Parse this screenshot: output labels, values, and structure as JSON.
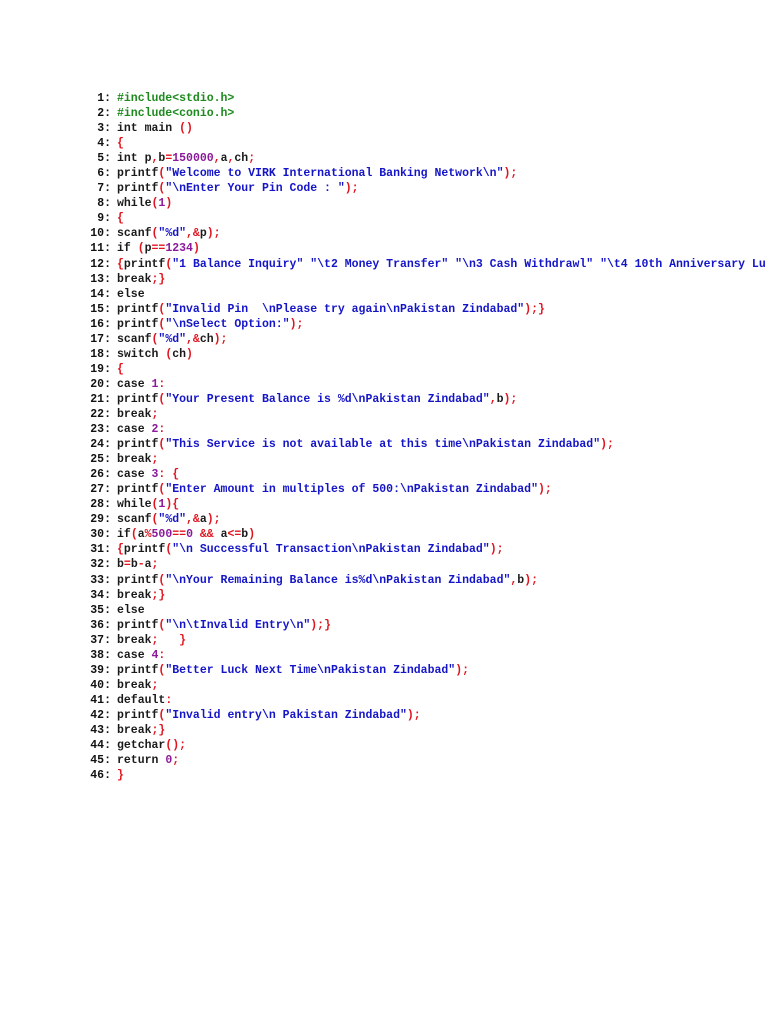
{
  "colors": {
    "keyword": "#1a1a1a",
    "punct": "#e0141e",
    "number": "#8b1a9a",
    "string": "#1515c8",
    "directive": "#1e8a1e"
  },
  "lines": [
    {
      "num": "1:",
      "t": [
        [
          "d",
          "#include<stdio.h>"
        ]
      ]
    },
    {
      "num": "2:",
      "t": [
        [
          "d",
          "#include<conio.h>"
        ]
      ]
    },
    {
      "num": "3:",
      "t": [
        [
          "k",
          "int main "
        ],
        [
          "p",
          "()"
        ]
      ]
    },
    {
      "num": "4:",
      "t": [
        [
          "p",
          "{"
        ]
      ]
    },
    {
      "num": "5:",
      "t": [
        [
          "k",
          "int p"
        ],
        [
          "p",
          ","
        ],
        [
          "k",
          "b"
        ],
        [
          "p",
          "="
        ],
        [
          "n",
          "150000"
        ],
        [
          "p",
          ","
        ],
        [
          "k",
          "a"
        ],
        [
          "p",
          ","
        ],
        [
          "k",
          "ch"
        ],
        [
          "p",
          ";"
        ]
      ]
    },
    {
      "num": "6:",
      "t": [
        [
          "k",
          "printf"
        ],
        [
          "p",
          "("
        ],
        [
          "s",
          "\"Welcome to VIRK International Banking Network\\n\""
        ],
        [
          "p",
          ");"
        ]
      ]
    },
    {
      "num": "7:",
      "t": [
        [
          "k",
          "printf"
        ],
        [
          "p",
          "("
        ],
        [
          "s",
          "\"\\nEnter Your Pin Code : \""
        ],
        [
          "p",
          ");"
        ]
      ]
    },
    {
      "num": "8:",
      "t": [
        [
          "k",
          "while"
        ],
        [
          "p",
          "("
        ],
        [
          "n",
          "1"
        ],
        [
          "p",
          ")"
        ]
      ]
    },
    {
      "num": "9:",
      "t": [
        [
          "p",
          "{"
        ]
      ]
    },
    {
      "num": "10:",
      "t": [
        [
          "k",
          "scanf"
        ],
        [
          "p",
          "("
        ],
        [
          "s",
          "\"%d\""
        ],
        [
          "p",
          ",&"
        ],
        [
          "k",
          "p"
        ],
        [
          "p",
          ");"
        ]
      ]
    },
    {
      "num": "11:",
      "t": [
        [
          "k",
          "if "
        ],
        [
          "p",
          "("
        ],
        [
          "k",
          "p"
        ],
        [
          "p",
          "=="
        ],
        [
          "n",
          "1234"
        ],
        [
          "p",
          ")"
        ]
      ]
    },
    {
      "num": "12:",
      "t": [
        [
          "p",
          "{"
        ],
        [
          "k",
          "printf"
        ],
        [
          "p",
          "("
        ],
        [
          "s",
          "\"1 Balance Inquiry\" \"\\t2 Money Transfer\" \"\\n3 Cash Withdrawl\" \"\\t4 10th Anniversary Lu"
        ]
      ]
    },
    {
      "num": "13:",
      "t": [
        [
          "k",
          "break"
        ],
        [
          "p",
          ";}"
        ]
      ]
    },
    {
      "num": "14:",
      "t": [
        [
          "k",
          "else"
        ]
      ]
    },
    {
      "num": "15:",
      "t": [
        [
          "k",
          "printf"
        ],
        [
          "p",
          "("
        ],
        [
          "s",
          "\"Invalid Pin  \\nPlease try again\\nPakistan Zindabad\""
        ],
        [
          "p",
          ");}"
        ]
      ]
    },
    {
      "num": "16:",
      "t": [
        [
          "k",
          "printf"
        ],
        [
          "p",
          "("
        ],
        [
          "s",
          "\"\\nSelect Option:\""
        ],
        [
          "p",
          ");"
        ]
      ]
    },
    {
      "num": "17:",
      "t": [
        [
          "k",
          "scanf"
        ],
        [
          "p",
          "("
        ],
        [
          "s",
          "\"%d\""
        ],
        [
          "p",
          ",&"
        ],
        [
          "k",
          "ch"
        ],
        [
          "p",
          ");"
        ]
      ]
    },
    {
      "num": "18:",
      "t": [
        [
          "k",
          "switch "
        ],
        [
          "p",
          "("
        ],
        [
          "k",
          "ch"
        ],
        [
          "p",
          ")"
        ]
      ]
    },
    {
      "num": "19:",
      "t": [
        [
          "p",
          "{"
        ]
      ]
    },
    {
      "num": "20:",
      "t": [
        [
          "k",
          "case "
        ],
        [
          "n",
          "1"
        ],
        [
          "p",
          ":"
        ]
      ]
    },
    {
      "num": "21:",
      "t": [
        [
          "k",
          "printf"
        ],
        [
          "p",
          "("
        ],
        [
          "s",
          "\"Your Present Balance is %d\\nPakistan Zindabad\""
        ],
        [
          "p",
          ","
        ],
        [
          "k",
          "b"
        ],
        [
          "p",
          ");"
        ]
      ]
    },
    {
      "num": "22:",
      "t": [
        [
          "k",
          "break"
        ],
        [
          "p",
          ";"
        ]
      ]
    },
    {
      "num": "23:",
      "t": [
        [
          "k",
          "case "
        ],
        [
          "n",
          "2"
        ],
        [
          "p",
          ":"
        ]
      ]
    },
    {
      "num": "24:",
      "t": [
        [
          "k",
          "printf"
        ],
        [
          "p",
          "("
        ],
        [
          "s",
          "\"This Service is not available at this time\\nPakistan Zindabad\""
        ],
        [
          "p",
          ");"
        ]
      ]
    },
    {
      "num": "25:",
      "t": [
        [
          "k",
          "break"
        ],
        [
          "p",
          ";"
        ]
      ]
    },
    {
      "num": "26:",
      "t": [
        [
          "k",
          "case "
        ],
        [
          "n",
          "3"
        ],
        [
          "p",
          ": {"
        ]
      ]
    },
    {
      "num": "27:",
      "t": [
        [
          "k",
          "printf"
        ],
        [
          "p",
          "("
        ],
        [
          "s",
          "\"Enter Amount in multiples of 500:\\nPakistan Zindabad\""
        ],
        [
          "p",
          ");"
        ]
      ]
    },
    {
      "num": "28:",
      "t": [
        [
          "k",
          "while"
        ],
        [
          "p",
          "("
        ],
        [
          "n",
          "1"
        ],
        [
          "p",
          "){"
        ]
      ]
    },
    {
      "num": "29:",
      "t": [
        [
          "k",
          "scanf"
        ],
        [
          "p",
          "("
        ],
        [
          "s",
          "\"%d\""
        ],
        [
          "p",
          ",&"
        ],
        [
          "k",
          "a"
        ],
        [
          "p",
          ");"
        ]
      ]
    },
    {
      "num": "30:",
      "t": [
        [
          "k",
          "if"
        ],
        [
          "p",
          "("
        ],
        [
          "k",
          "a"
        ],
        [
          "p",
          "%"
        ],
        [
          "n",
          "500"
        ],
        [
          "p",
          "=="
        ],
        [
          "n",
          "0"
        ],
        [
          "p",
          " && "
        ],
        [
          "k",
          "a"
        ],
        [
          "p",
          "<="
        ],
        [
          "k",
          "b"
        ],
        [
          "p",
          ")"
        ]
      ]
    },
    {
      "num": "31:",
      "t": [
        [
          "p",
          "{"
        ],
        [
          "k",
          "printf"
        ],
        [
          "p",
          "("
        ],
        [
          "s",
          "\"\\n Successful Transaction\\nPakistan Zindabad\""
        ],
        [
          "p",
          ");"
        ]
      ]
    },
    {
      "num": "32:",
      "t": [
        [
          "k",
          "b"
        ],
        [
          "p",
          "="
        ],
        [
          "k",
          "b"
        ],
        [
          "p",
          "-"
        ],
        [
          "k",
          "a"
        ],
        [
          "p",
          ";"
        ]
      ]
    },
    {
      "num": "33:",
      "t": [
        [
          "k",
          "printf"
        ],
        [
          "p",
          "("
        ],
        [
          "s",
          "\"\\nYour Remaining Balance is%d\\nPakistan Zindabad\""
        ],
        [
          "p",
          ","
        ],
        [
          "k",
          "b"
        ],
        [
          "p",
          ");"
        ]
      ]
    },
    {
      "num": "34:",
      "t": [
        [
          "k",
          "break"
        ],
        [
          "p",
          ";}"
        ]
      ]
    },
    {
      "num": "35:",
      "t": [
        [
          "k",
          "else"
        ]
      ]
    },
    {
      "num": "36:",
      "t": [
        [
          "k",
          "printf"
        ],
        [
          "p",
          "("
        ],
        [
          "s",
          "\"\\n\\tInvalid Entry\\n\""
        ],
        [
          "p",
          ");}"
        ]
      ]
    },
    {
      "num": "37:",
      "t": [
        [
          "k",
          "break"
        ],
        [
          "p",
          ";   }"
        ]
      ]
    },
    {
      "num": "38:",
      "t": [
        [
          "k",
          "case "
        ],
        [
          "n",
          "4"
        ],
        [
          "p",
          ":"
        ]
      ]
    },
    {
      "num": "39:",
      "t": [
        [
          "k",
          "printf"
        ],
        [
          "p",
          "("
        ],
        [
          "s",
          "\"Better Luck Next Time\\nPakistan Zindabad\""
        ],
        [
          "p",
          ");"
        ]
      ]
    },
    {
      "num": "40:",
      "t": [
        [
          "k",
          "break"
        ],
        [
          "p",
          ";"
        ]
      ]
    },
    {
      "num": "41:",
      "t": [
        [
          "k",
          "default"
        ],
        [
          "p",
          ":"
        ]
      ]
    },
    {
      "num": "42:",
      "t": [
        [
          "k",
          "printf"
        ],
        [
          "p",
          "("
        ],
        [
          "s",
          "\"Invalid entry\\n Pakistan Zindabad\""
        ],
        [
          "p",
          ");"
        ]
      ]
    },
    {
      "num": "43:",
      "t": [
        [
          "k",
          "break"
        ],
        [
          "p",
          ";}"
        ]
      ]
    },
    {
      "num": "44:",
      "t": [
        [
          "k",
          "getchar"
        ],
        [
          "p",
          "();"
        ]
      ]
    },
    {
      "num": "45:",
      "t": [
        [
          "k",
          "return "
        ],
        [
          "n",
          "0"
        ],
        [
          "p",
          ";"
        ]
      ]
    },
    {
      "num": "46:",
      "t": [
        [
          "p",
          "}"
        ]
      ]
    }
  ]
}
